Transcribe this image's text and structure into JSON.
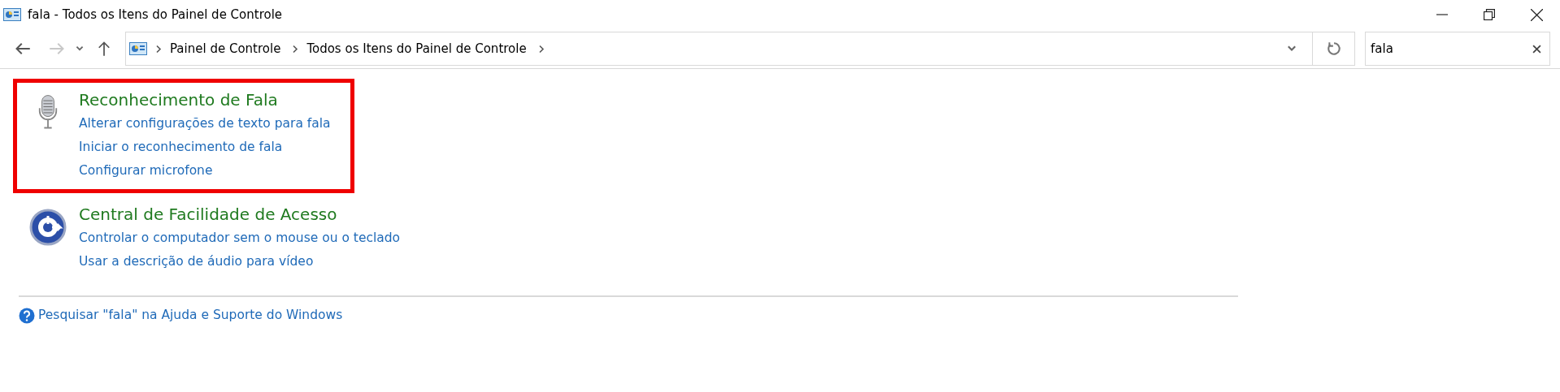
{
  "window": {
    "title": "fala - Todos os Itens do Painel de Controle"
  },
  "address_bar": {
    "breadcrumbs": [
      "Painel de Controle",
      "Todos os Itens do Painel de Controle"
    ]
  },
  "search": {
    "value": "fala"
  },
  "results": [
    {
      "kind": "microphone",
      "highlighted": true,
      "title": "Reconhecimento de Fala",
      "links": [
        "Alterar configurações de texto para fala",
        "Iniciar o reconhecimento de fala",
        "Configurar microfone"
      ]
    },
    {
      "kind": "accessibility",
      "highlighted": false,
      "title": "Central de Facilidade de Acesso",
      "links": [
        "Controlar o computador sem o mouse ou o teclado",
        "Usar a descrição de áudio para vídeo"
      ]
    }
  ],
  "help_link": "Pesquisar \"fala\" na Ajuda e Suporte do Windows"
}
